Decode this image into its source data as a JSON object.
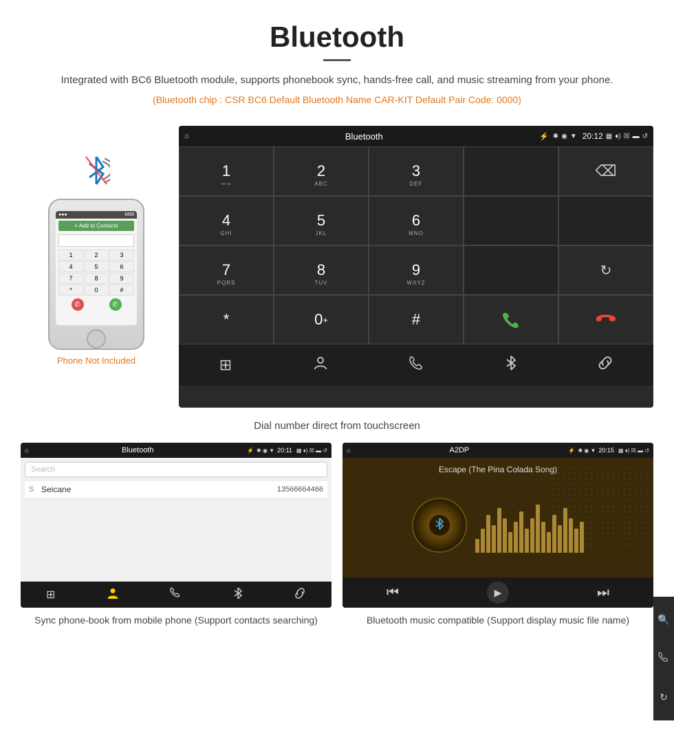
{
  "header": {
    "title": "Bluetooth",
    "description": "Integrated with BC6 Bluetooth module, supports phonebook sync, hands-free call, and music streaming from your phone.",
    "specs": "(Bluetooth chip : CSR BC6    Default Bluetooth Name CAR-KIT    Default Pair Code: 0000)"
  },
  "dial_screen": {
    "statusbar": {
      "home_icon": "⌂",
      "title": "Bluetooth",
      "usb_icon": "⚡",
      "bt_icon": "✱",
      "location_icon": "◉",
      "signal_icon": "▼",
      "time": "20:12",
      "camera_icon": "▦",
      "volume_icon": "♦",
      "close_icon": "☒",
      "window_icon": "▬",
      "back_icon": "↺"
    },
    "keys": [
      {
        "number": "1",
        "sub": "∾∾",
        "col": 1
      },
      {
        "number": "2",
        "sub": "ABC",
        "col": 2
      },
      {
        "number": "3",
        "sub": "DEF",
        "col": 3
      },
      {
        "number": "4",
        "sub": "GHI",
        "col": 1
      },
      {
        "number": "5",
        "sub": "JKL",
        "col": 2
      },
      {
        "number": "6",
        "sub": "MNO",
        "col": 3
      },
      {
        "number": "7",
        "sub": "PQRS",
        "col": 1
      },
      {
        "number": "8",
        "sub": "TUV",
        "col": 2
      },
      {
        "number": "9",
        "sub": "WXYZ",
        "col": 3
      },
      {
        "number": "*",
        "sub": "",
        "col": 1
      },
      {
        "number": "0+",
        "sub": "",
        "col": 2
      },
      {
        "number": "#",
        "sub": "",
        "col": 3
      }
    ],
    "bottom_icons": [
      "⊞",
      "👤",
      "☎",
      "✱",
      "🔗"
    ]
  },
  "phone_mock": {
    "not_included": "Phone Not Included",
    "screen_bar": "                    M99",
    "contacts_label": "+ Add to Contacts",
    "keys": [
      "1",
      "2",
      "3",
      "4",
      "5",
      "6",
      "7",
      "8",
      "9",
      "*",
      "0",
      "#"
    ]
  },
  "main_caption": "Dial number direct from touchscreen",
  "phonebook_screen": {
    "statusbar_title": "Bluetooth",
    "search_placeholder": "Search",
    "contact_name": "Seicane",
    "contact_number": "13566664466",
    "contact_letter": "S"
  },
  "music_screen": {
    "statusbar_title": "A2DP",
    "time": "20:15",
    "song_title": "Escape (The Pina Colada Song)",
    "eq_heights": [
      20,
      35,
      55,
      40,
      65,
      50,
      30,
      45,
      60,
      35,
      50,
      70,
      45,
      30,
      55,
      40,
      65,
      50,
      35,
      45
    ]
  },
  "bottom_captions": {
    "phonebook": "Sync phone-book from mobile phone\n(Support contacts searching)",
    "music": "Bluetooth music compatible\n(Support display music file name)"
  }
}
